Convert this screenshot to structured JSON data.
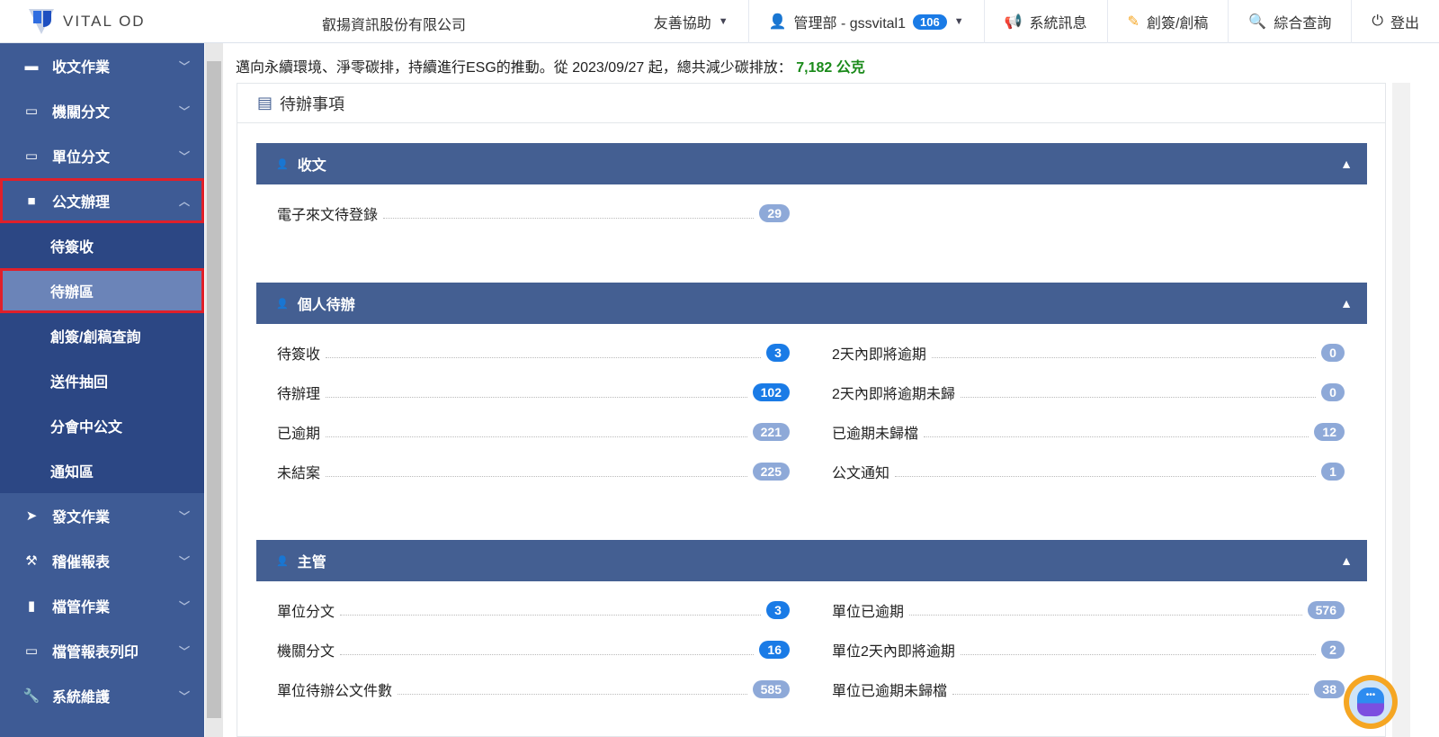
{
  "header": {
    "logo_text": "VITAL OD",
    "company": "叡揚資訊股份有限公司",
    "nav": [
      {
        "label": "友善協助",
        "icon": "",
        "caret": true,
        "name": "accessibility-menu"
      },
      {
        "label": "管理部 - gssvital1",
        "icon": "user-icon",
        "badge": "106",
        "caret": true,
        "name": "user-menu"
      },
      {
        "label": "系統訊息",
        "icon": "megaphone-icon",
        "name": "system-message-button"
      },
      {
        "label": "創簽/創稿",
        "icon": "edit-icon",
        "name": "create-draft-button"
      },
      {
        "label": "綜合查詢",
        "icon": "search-icon",
        "name": "search-button"
      },
      {
        "label": "登出",
        "icon": "power-icon",
        "name": "logout-button"
      }
    ]
  },
  "sidebar": {
    "items": [
      {
        "label": "收文作業",
        "icon": "folder-icon"
      },
      {
        "label": "機關分文",
        "icon": "folder-open-icon"
      },
      {
        "label": "單位分文",
        "icon": "folder-open-icon"
      },
      {
        "label": "公文辦理",
        "icon": "briefcase-icon",
        "open": true,
        "sub": [
          {
            "label": "待簽收"
          },
          {
            "label": "待辦區",
            "active": true
          },
          {
            "label": "創簽/創稿查詢"
          },
          {
            "label": "送件抽回"
          },
          {
            "label": "分會中公文"
          },
          {
            "label": "通知區"
          }
        ]
      },
      {
        "label": "發文作業",
        "icon": "paper-plane-icon"
      },
      {
        "label": "稽催報表",
        "icon": "gavel-icon"
      },
      {
        "label": "檔管作業",
        "icon": "clipboard-icon"
      },
      {
        "label": "檔管報表列印",
        "icon": "folder-open-icon"
      },
      {
        "label": "系統維護",
        "icon": "wrench-icon"
      }
    ]
  },
  "notice": {
    "prefix": "邁向永續環境、淨零碳排，持續進行ESG的推動。從 2023/09/27 起，總共減少碳排放：",
    "amount": "7,182 公克"
  },
  "card": {
    "title": "待辦事項"
  },
  "sections": [
    {
      "title": "收文",
      "left": [
        {
          "label": "電子來文待登錄",
          "value": "29",
          "style": "light"
        }
      ],
      "right": []
    },
    {
      "title": "個人待辦",
      "left": [
        {
          "label": "待簽收",
          "value": "3",
          "style": "blue"
        },
        {
          "label": "待辦理",
          "value": "102",
          "style": "blue"
        },
        {
          "label": "已逾期",
          "value": "221",
          "style": "light"
        },
        {
          "label": "未結案",
          "value": "225",
          "style": "light"
        }
      ],
      "right": [
        {
          "label": "2天內即將逾期",
          "value": "0",
          "style": "light"
        },
        {
          "label": "2天內即將逾期未歸",
          "value": "0",
          "style": "light"
        },
        {
          "label": "已逾期未歸檔",
          "value": "12",
          "style": "light"
        },
        {
          "label": "公文通知",
          "value": "1",
          "style": "light"
        }
      ]
    },
    {
      "title": "主管",
      "left": [
        {
          "label": "單位分文",
          "value": "3",
          "style": "blue"
        },
        {
          "label": "機關分文",
          "value": "16",
          "style": "blue"
        },
        {
          "label": "單位待辦公文件數",
          "value": "585",
          "style": "light"
        }
      ],
      "right": [
        {
          "label": "單位已逾期",
          "value": "576",
          "style": "light"
        },
        {
          "label": "單位2天內即將逾期",
          "value": "2",
          "style": "light"
        },
        {
          "label": "單位已逾期未歸檔",
          "value": "38",
          "style": "light"
        }
      ]
    }
  ],
  "colors": {
    "sidebar": "#3e5b95",
    "section_header": "#445f92",
    "badge_blue": "#1a7be6",
    "badge_light": "#8ea9d8"
  }
}
